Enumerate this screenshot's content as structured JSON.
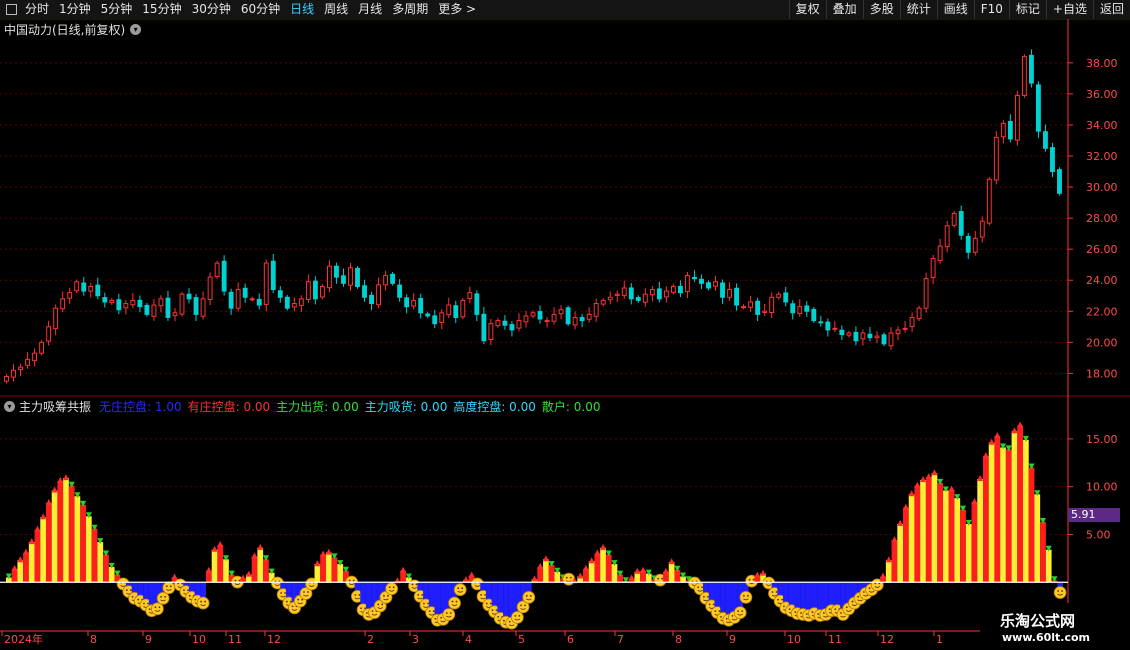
{
  "toolbar": {
    "items": [
      "分时",
      "1分钟",
      "5分钟",
      "15分钟",
      "30分钟",
      "60分钟",
      "日线",
      "周线",
      "月线",
      "多周期",
      "更多 >"
    ],
    "active": "日线",
    "right": [
      "复权",
      "叠加",
      "多股",
      "统计",
      "画线",
      "F10",
      "标记",
      "+自选",
      "返回"
    ]
  },
  "main_title": "中国动力(日线,前复权)",
  "indicator": {
    "name": "主力吸筹共振",
    "fields": [
      {
        "label": "无庄控盘: 1.00",
        "color": "#2828ff"
      },
      {
        "label": "有庄控盘: 0.00",
        "color": "#ff3030"
      },
      {
        "label": "主力出货: 0.00",
        "color": "#30e030"
      },
      {
        "label": "主力吸货: 0.00",
        "color": "#30d8ff"
      },
      {
        "label": "高度控盘: 0.00",
        "color": "#30d8ff"
      },
      {
        "label": "散户: 0.00",
        "color": "#30e030"
      }
    ],
    "value_badge": "5.91"
  },
  "watermark": {
    "line1": "乐淘公式网",
    "line2": "www.60lt.com"
  },
  "colors": {
    "up": "#ff3232",
    "down": "#00d2d2",
    "grid": "#5a0000",
    "axis": "#ff3232"
  },
  "chart_data": [
    {
      "type": "candlestick",
      "title": "中国动力(日线,前复权)",
      "ylim": [
        16.8,
        39.6
      ],
      "y_ticks": [
        "18.00",
        "20.00",
        "22.00",
        "24.00",
        "26.00",
        "28.00",
        "30.00",
        "32.00",
        "34.00",
        "36.00",
        "38.00"
      ],
      "x_ticks": [
        "2024年",
        "8",
        "9",
        "10",
        "11",
        "12",
        "2",
        "3",
        "4",
        "5",
        "6",
        "7",
        "8",
        "9",
        "10",
        "11",
        "12",
        "1"
      ],
      "close": [
        17.8,
        18.2,
        18.4,
        18.9,
        19.3,
        20.0,
        21.0,
        22.2,
        22.8,
        23.2,
        23.9,
        23.3,
        23.6,
        23.0,
        22.6,
        22.7,
        22.1,
        22.5,
        22.7,
        22.3,
        21.8,
        22.4,
        22.8,
        21.6,
        21.9,
        23.1,
        22.8,
        21.8,
        22.8,
        24.2,
        25.1,
        23.3,
        22.2,
        23.4,
        22.9,
        22.8,
        22.4,
        25.1,
        23.4,
        22.9,
        22.2,
        22.5,
        22.8,
        23.9,
        22.8,
        23.6,
        24.9,
        24.2,
        23.8,
        24.8,
        23.6,
        22.9,
        22.5,
        23.7,
        24.3,
        23.8,
        22.9,
        22.3,
        22.7,
        21.9,
        21.7,
        21.2,
        21.9,
        22.4,
        21.6,
        22.7,
        23.2,
        21.8,
        20.1,
        21.2,
        21.4,
        21.1,
        20.8,
        21.4,
        21.7,
        21.9,
        21.5,
        21.4,
        21.8,
        22.1,
        21.2,
        21.6,
        21.4,
        21.8,
        22.5,
        22.7,
        22.9,
        23.1,
        23.5,
        22.8,
        22.7,
        23.1,
        23.4,
        22.8,
        23.3,
        23.6,
        23.2,
        24.3,
        24.1,
        23.8,
        23.5,
        23.9,
        22.9,
        23.4,
        22.4,
        22.3,
        22.6,
        21.8,
        22.0,
        22.9,
        23.1,
        22.6,
        21.9,
        22.3,
        22.0,
        21.4,
        21.3,
        20.8,
        20.9,
        20.5,
        20.6,
        20.1,
        20.6,
        20.3,
        20.4,
        19.9,
        20.6,
        20.8,
        20.9,
        21.6,
        22.2,
        24.1,
        25.4,
        26.2,
        27.5,
        28.3,
        26.9,
        25.8,
        26.7,
        27.8,
        30.5,
        33.2,
        34.1,
        33.1,
        35.9,
        38.4,
        36.7,
        33.6,
        32.5,
        31.0,
        29.6
      ]
    },
    {
      "type": "oscillator",
      "title": "主力吸筹共振",
      "ylim": [
        -5,
        17.5
      ],
      "y_ticks": [
        "5.00",
        "10.00",
        "15.00"
      ],
      "values": [
        0.5,
        1.4,
        2.3,
        3.1,
        4.2,
        5.5,
        6.8,
        8.3,
        9.6,
        10.6,
        10.9,
        10.1,
        9.0,
        8.1,
        6.9,
        5.6,
        4.2,
        2.9,
        1.6,
        0.8,
        -0.6,
        -1.4,
        -2.1,
        -2.4,
        -2.8,
        -3.4,
        -3.2,
        -2.1,
        -1.0,
        0.5,
        -0.7,
        -1.4,
        -2.0,
        -2.4,
        -2.6,
        1.2,
        3.4,
        3.9,
        2.4,
        0.8,
        -0.4,
        0.4,
        0.8,
        2.7,
        3.6,
        2.4,
        1.0,
        -0.5,
        -1.7,
        -2.6,
        -3.1,
        -2.4,
        -1.6,
        -0.6,
        1.9,
        2.9,
        3.1,
        2.6,
        1.9,
        1.2,
        -0.4,
        -1.9,
        -3.3,
        -3.8,
        -3.6,
        -2.9,
        -2.0,
        -1.1,
        0.1,
        1.2,
        0.5,
        -0.8,
        -1.9,
        -2.8,
        -3.6,
        -4.4,
        -4.3,
        -3.8,
        -2.6,
        -1.2,
        0.2,
        0.7,
        -0.6,
        -1.9,
        -2.8,
        -3.5,
        -4.2,
        -4.6,
        -4.7,
        -4.1,
        -3.0,
        -2.0,
        0.3,
        1.6,
        2.4,
        1.8,
        1.1,
        0.4,
        -0.1,
        0.1,
        0.6,
        1.4,
        2.2,
        3.0,
        3.6,
        2.9,
        1.9,
        0.8,
        0.1,
        0.4,
        1.1,
        1.2,
        0.9,
        0.3,
        -0.2,
        1.1,
        2.1,
        1.3,
        0.6,
        0.2,
        -0.5,
        -1.1,
        -2.1,
        -2.9,
        -3.6,
        -4.2,
        -4.4,
        -4.1,
        -3.6,
        -2.0,
        -0.3,
        0.7,
        0.9,
        -0.5,
        -1.6,
        -2.4,
        -3.1,
        -3.4,
        -3.7,
        -3.8,
        -3.9,
        -3.7,
        -3.9,
        -3.8,
        -3.4,
        -3.4,
        -3.8,
        -3.2,
        -2.6,
        -2.1,
        -1.6,
        -1.2,
        -0.7,
        0.6,
        2.3,
        4.4,
        6.1,
        7.8,
        9.2,
        10.1,
        10.7,
        11.0,
        11.4,
        10.4,
        9.6,
        9.7,
        8.8,
        7.6,
        6.1,
        8.4,
        10.8,
        13.2,
        14.6,
        15.3,
        14.1,
        13.9,
        15.8,
        16.4,
        14.9,
        12.0,
        9.2,
        6.3,
        3.4,
        0.2,
        -1.5
      ]
    }
  ]
}
